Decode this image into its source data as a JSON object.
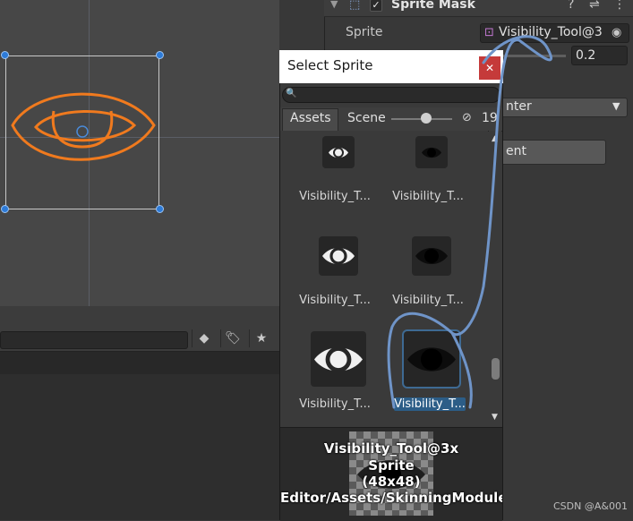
{
  "inspector": {
    "component_title": "Sprite Mask",
    "enabled_check": "✓",
    "sprite_label": "Sprite",
    "sprite_value": "Visibility_Tool@3",
    "alpha_cutoff_value": "0.2",
    "dropdown_value": "nter",
    "button_label": "ent"
  },
  "dialog": {
    "title": "Select Sprite",
    "close": "✕",
    "tabs": {
      "assets": "Assets",
      "scene": "Scene"
    },
    "hidden_count": "19",
    "items": [
      {
        "label": "Visibility_T...",
        "tone": "white",
        "size": "small",
        "selected": false
      },
      {
        "label": "Visibility_T...",
        "tone": "dark",
        "size": "small",
        "selected": false
      },
      {
        "label": "Visibility_T...",
        "tone": "white",
        "size": "medium",
        "selected": false
      },
      {
        "label": "Visibility_T...",
        "tone": "dark",
        "size": "medium",
        "selected": false
      },
      {
        "label": "Visibility_T...",
        "tone": "white",
        "size": "large",
        "selected": false
      },
      {
        "label": "Visibility_T...",
        "tone": "dark",
        "size": "large",
        "selected": true
      }
    ],
    "preview": {
      "name": "Visibility_Tool@3x",
      "type": "Sprite",
      "dimensions": "(48x48)",
      "path": "Editor/Assets/SkinningModule/I"
    }
  },
  "colors": {
    "accent": "#2c5d87",
    "close_red": "#c53a3a",
    "sprite_orange": "#f07a1e",
    "annotation_blue": "#6f94c8"
  },
  "watermark": "CSDN @A&001"
}
